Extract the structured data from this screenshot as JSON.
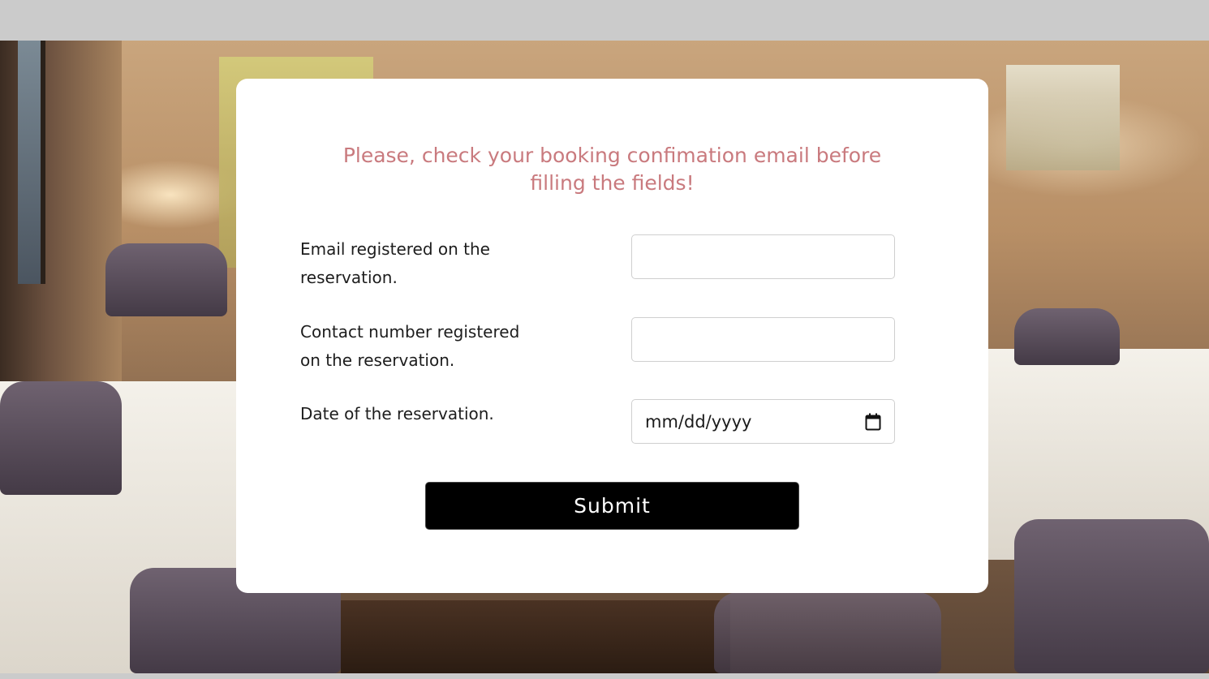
{
  "form": {
    "heading": "Please, check your booking confimation email before filling the fields!",
    "email_label": "Email registered on the reservation.",
    "phone_label": "Contact number registered on the reservation.",
    "date_label": "Date of the reservation.",
    "email_value": "",
    "phone_value": "",
    "date_placeholder": "mm/dd/yyyy",
    "date_icon": "calendar-icon",
    "submit_label": "Submit"
  },
  "colors": {
    "heading": "#c97a7e",
    "button_background": "#000000",
    "button_text": "#ffffff",
    "card_background": "#ffffff",
    "frame_bars": "#cbcbcb"
  }
}
